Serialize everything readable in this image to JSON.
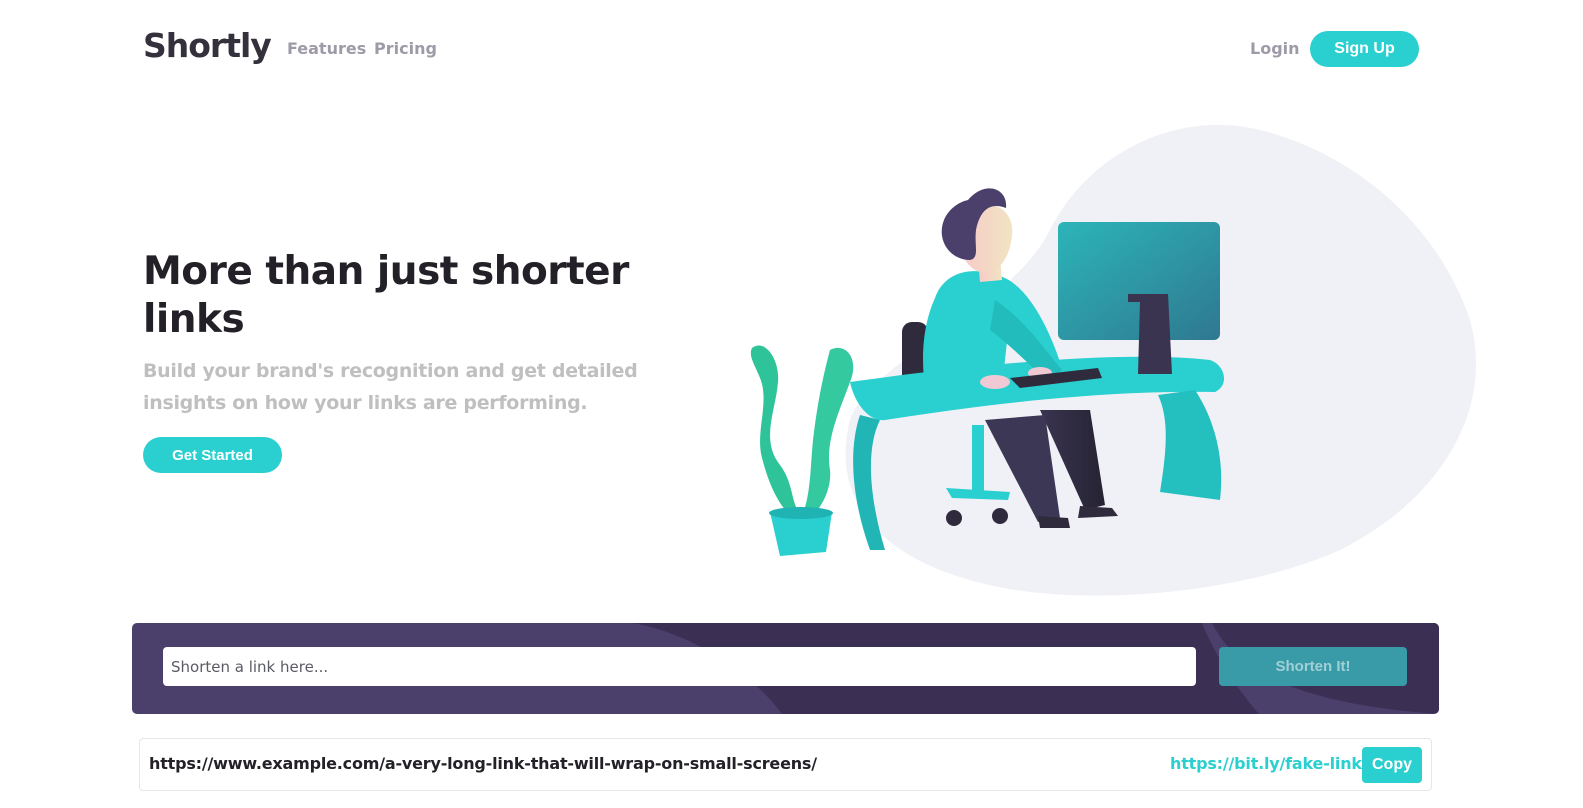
{
  "header": {
    "logo": "Shortly",
    "nav_links": [
      "Features",
      "Pricing"
    ],
    "login_label": "Login",
    "signup_label": "Sign Up"
  },
  "hero": {
    "title_line1": "More than just shorter",
    "title_line2": "links",
    "subtitle_line1": "Build your brand's recognition and get detailed",
    "subtitle_line2": "insights on how your links are performing.",
    "cta_label": "Get Started"
  },
  "shorten": {
    "placeholder": "Shorten a link here...",
    "button_label": "Shorten It!"
  },
  "results": [
    {
      "original": "https://www.example.com/a-very-long-link-that-will-wrap-on-small-screens/",
      "short": "https://bit.ly/fake-link",
      "copy_label": "Copy"
    }
  ],
  "colors": {
    "accent": "#2acfcf",
    "panel": "#4b3f6b",
    "text_dark": "#232127",
    "text_muted": "#9e9aa7"
  }
}
